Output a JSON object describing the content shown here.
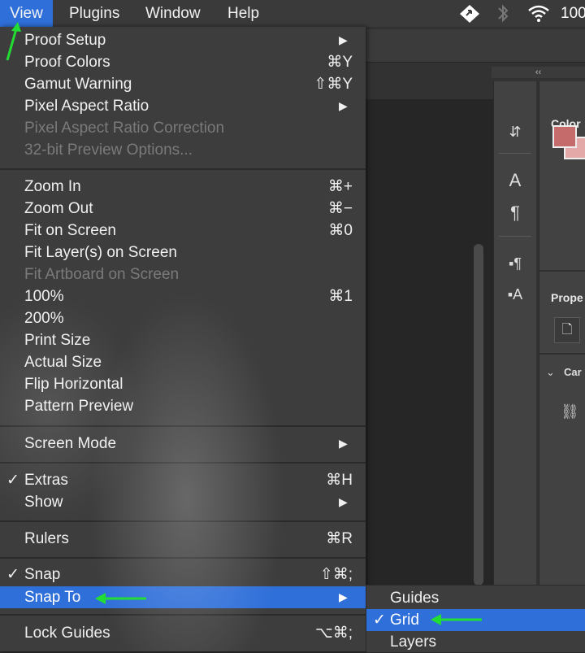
{
  "menubar": {
    "items": [
      "View",
      "Plugins",
      "Window",
      "Help"
    ],
    "battery_text": "100"
  },
  "view_menu": {
    "proof_setup": "Proof Setup",
    "proof_colors": "Proof Colors",
    "proof_colors_sc": "⌘Y",
    "gamut_warning": "Gamut Warning",
    "gamut_warning_sc": "⇧⌘Y",
    "pixel_aspect_ratio": "Pixel Aspect Ratio",
    "pixel_aspect_ratio_correction": "Pixel Aspect Ratio Correction",
    "preview_options": "32-bit Preview Options...",
    "zoom_in": "Zoom In",
    "zoom_in_sc": "⌘+",
    "zoom_out": "Zoom Out",
    "zoom_out_sc": "⌘−",
    "fit_on_screen": "Fit on Screen",
    "fit_on_screen_sc": "⌘0",
    "fit_layers": "Fit Layer(s) on Screen",
    "fit_artboard": "Fit Artboard on Screen",
    "p100": "100%",
    "p100_sc": "⌘1",
    "p200": "200%",
    "print_size": "Print Size",
    "actual_size": "Actual Size",
    "flip_horizontal": "Flip Horizontal",
    "pattern_preview": "Pattern Preview",
    "screen_mode": "Screen Mode",
    "extras": "Extras",
    "extras_sc": "⌘H",
    "show": "Show",
    "rulers": "Rulers",
    "rulers_sc": "⌘R",
    "snap": "Snap",
    "snap_sc": "⇧⌘;",
    "snap_to": "Snap To",
    "lock_guides": "Lock Guides",
    "lock_guides_sc": "⌥⌘;",
    "checkmark": "✓",
    "submenu_arrow": "▶"
  },
  "snap_to_menu": {
    "guides": "Guides",
    "grid": "Grid",
    "layers": "Layers"
  },
  "panels": {
    "color_title": "Color",
    "properties_title": "Prope",
    "camera_label": "Car",
    "collapse": "‹‹"
  },
  "colors": {
    "accent": "#2f6fd9",
    "annotation_arrow": "#22dd33",
    "foreground_swatch": "#c56b6b",
    "background_swatch": "#e3a8a8"
  },
  "icons": [
    "arrow-pointer-icon",
    "bluetooth-icon",
    "wifi-icon",
    "paragraph-icon",
    "character-icon",
    "link-icon",
    "document-icon"
  ]
}
